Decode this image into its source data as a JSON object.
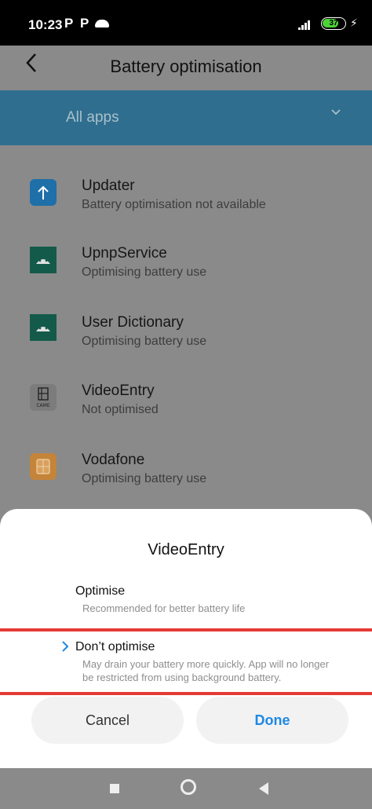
{
  "status_bar": {
    "time": "10:23",
    "notification_icons": [
      "P",
      "P"
    ],
    "battery_level": "37",
    "cloud_icon": "cloud-icon",
    "charging_icon": "lightning-icon"
  },
  "header": {
    "back_icon": "chevron-left-icon",
    "title": "Battery optimisation"
  },
  "filter": {
    "label": "All apps",
    "icon": "chevron-down-icon"
  },
  "apps": [
    {
      "name": "Updater",
      "status": "Battery optimisation not available",
      "icon": "updater-icon"
    },
    {
      "name": "UpnpService",
      "status": "Optimising battery use",
      "icon": "android-icon"
    },
    {
      "name": "User Dictionary",
      "status": "Optimising battery use",
      "icon": "android-icon"
    },
    {
      "name": "VideoEntry",
      "status": "Not optimised",
      "icon": "videoentry-icon",
      "icon_caption": "CAME"
    },
    {
      "name": "Vodafone",
      "status": "Optimising battery use",
      "icon": "sim-card-icon"
    }
  ],
  "sheet": {
    "title": "VideoEntry",
    "options": [
      {
        "label": "Optimise",
        "description": "Recommended for better battery life",
        "selected": false
      },
      {
        "label": "Don’t optimise",
        "description": "May drain your battery more quickly. App will no longer be restricted from using background battery.",
        "selected": true
      }
    ],
    "cancel_label": "Cancel",
    "done_label": "Done"
  },
  "nav_bar": {
    "icons": [
      "recents-icon",
      "home-icon",
      "back-icon"
    ]
  },
  "colors": {
    "accent": "#1e88e5",
    "filter_bg": "#2f6e8e",
    "highlight": "#e53935"
  }
}
